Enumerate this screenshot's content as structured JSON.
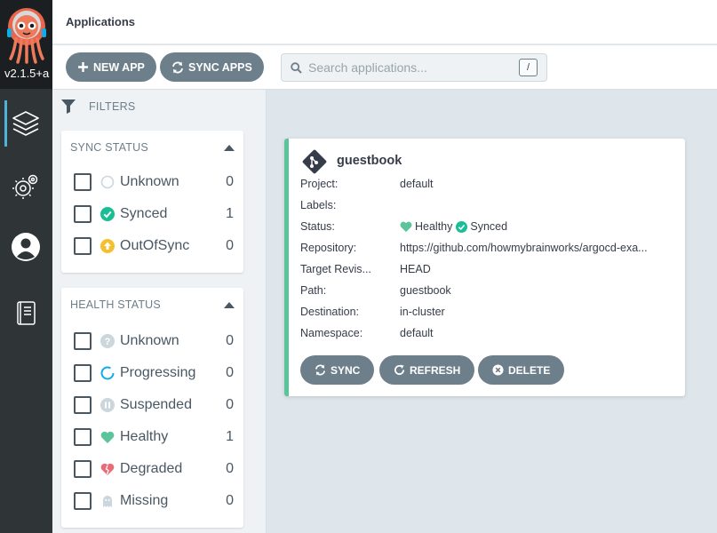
{
  "nav": {
    "version": "v2.1.5+a",
    "items": [
      {
        "icon": "applications-layers-icon"
      },
      {
        "icon": "settings-gear-icon"
      },
      {
        "icon": "user-account-icon"
      },
      {
        "icon": "documentation-book-icon"
      }
    ]
  },
  "header": {
    "title": "Applications"
  },
  "toolbar": {
    "new_app": "NEW APP",
    "sync_apps": "SYNC APPS",
    "search_placeholder": "Search applications...",
    "search_shortcut": "/"
  },
  "filters": {
    "label": "FILTERS",
    "sync_status": {
      "title": "SYNC STATUS",
      "items": [
        {
          "label": "Unknown",
          "count": "0",
          "icon": "unknown-circle-icon"
        },
        {
          "label": "Synced",
          "count": "1",
          "icon": "synced-check-icon"
        },
        {
          "label": "OutOfSync",
          "count": "0",
          "icon": "out-of-sync-arrow-icon"
        }
      ]
    },
    "health_status": {
      "title": "HEALTH STATUS",
      "items": [
        {
          "label": "Unknown",
          "count": "0",
          "icon": "question-circle-icon"
        },
        {
          "label": "Progressing",
          "count": "0",
          "icon": "progressing-ring-icon"
        },
        {
          "label": "Suspended",
          "count": "0",
          "icon": "pause-circle-icon"
        },
        {
          "label": "Healthy",
          "count": "1",
          "icon": "heart-icon"
        },
        {
          "label": "Degraded",
          "count": "0",
          "icon": "broken-heart-icon"
        },
        {
          "label": "Missing",
          "count": "0",
          "icon": "ghost-icon"
        }
      ]
    }
  },
  "app": {
    "name": "guestbook",
    "fields": [
      {
        "key": "Project:",
        "value": "default"
      },
      {
        "key": "Labels:",
        "value": ""
      },
      {
        "key": "Status:",
        "health": "Healthy",
        "sync": "Synced"
      },
      {
        "key": "Repository:",
        "value": "https://github.com/howmybrainworks/argocd-exa..."
      },
      {
        "key": "Target Revis...",
        "value": "HEAD"
      },
      {
        "key": "Path:",
        "value": "guestbook"
      },
      {
        "key": "Destination:",
        "value": "in-cluster"
      },
      {
        "key": "Namespace:",
        "value": "default"
      }
    ],
    "actions": {
      "sync": "SYNC",
      "refresh": "REFRESH",
      "delete": "DELETE"
    }
  },
  "colors": {
    "nav_bg": "#2f3437",
    "button_bg": "#6d7f8b",
    "healthy": "#5cc49a",
    "synced": "#18be94",
    "out_of_sync": "#f4c030",
    "degraded": "#e96d76",
    "progressing": "#0dadea"
  }
}
